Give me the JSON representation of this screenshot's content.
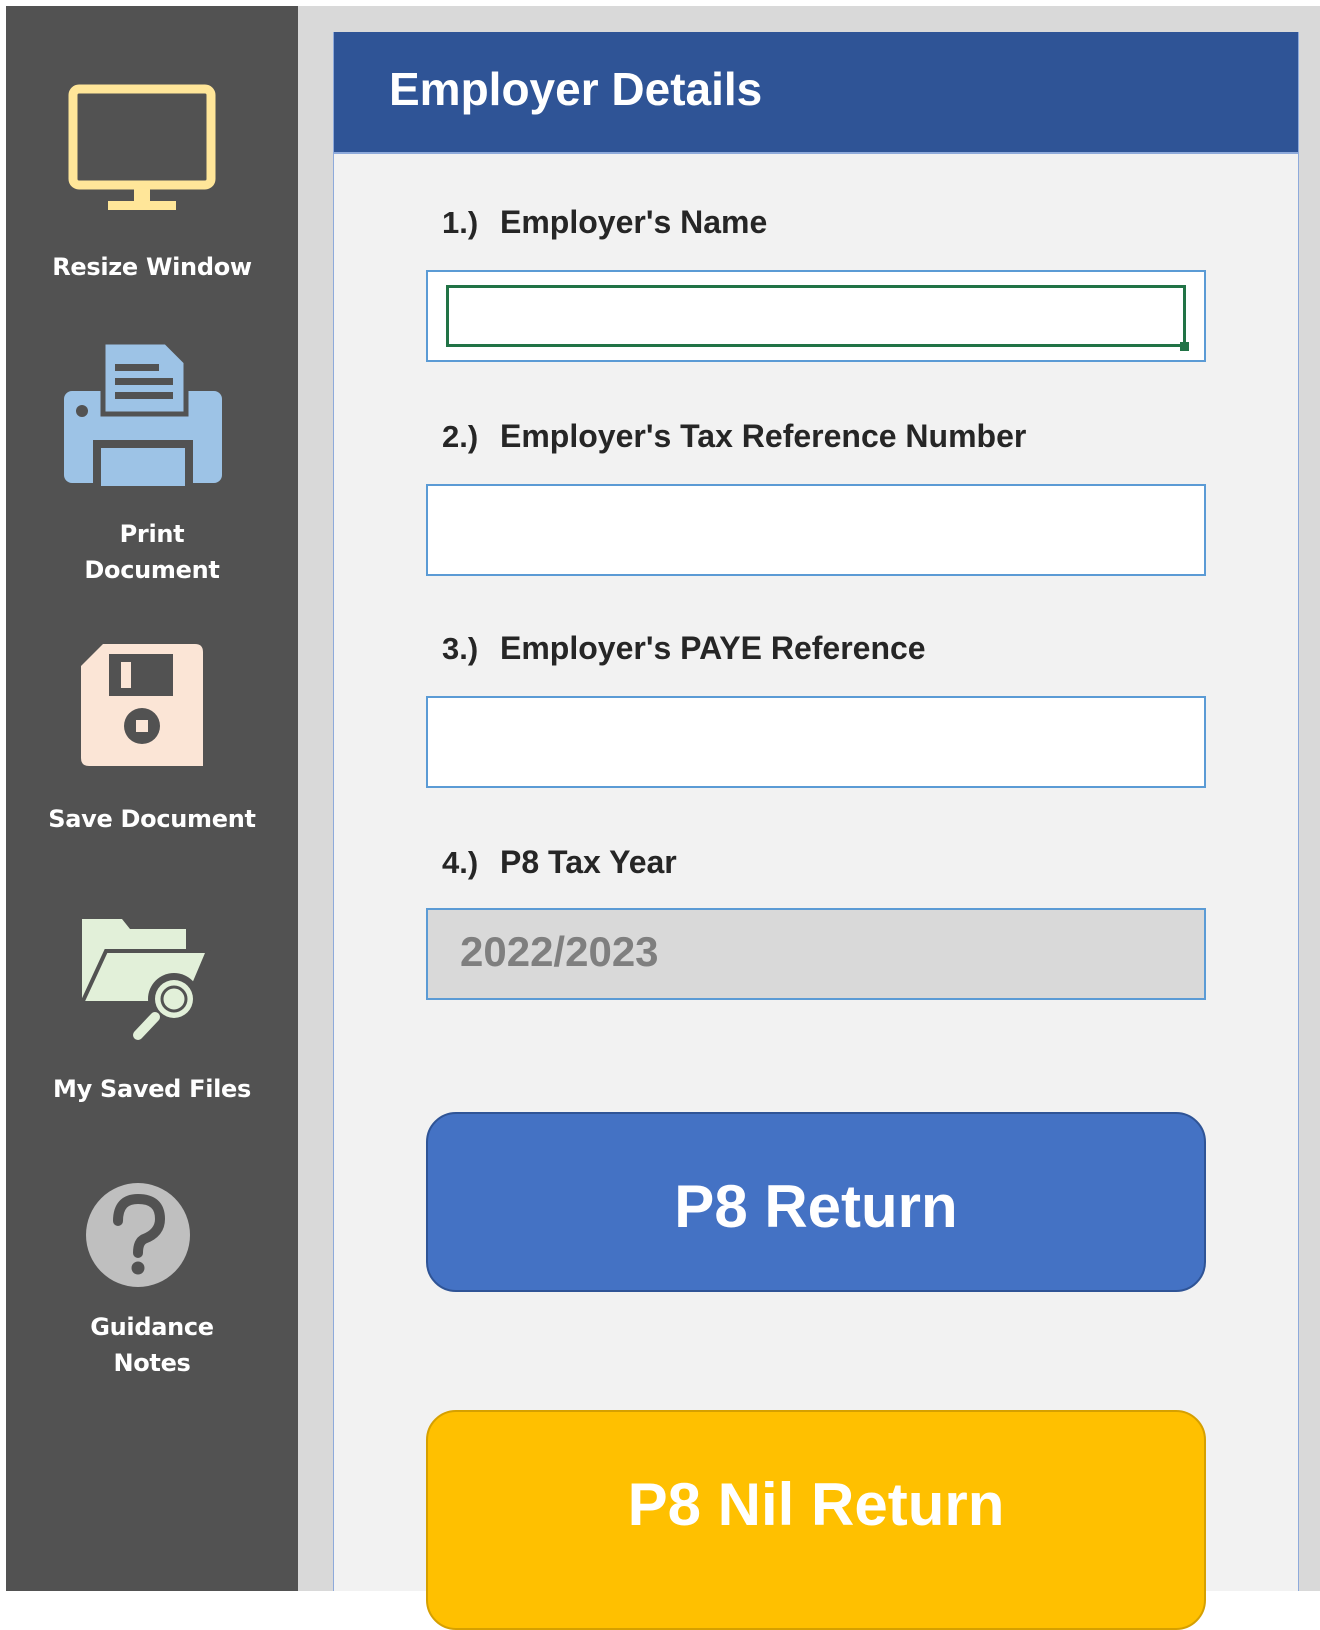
{
  "sidebar": {
    "items": [
      {
        "label": "Resize Window",
        "icon": "monitor-icon"
      },
      {
        "label": "Print\nDocument",
        "icon": "printer-icon"
      },
      {
        "label": "Save Document",
        "icon": "floppy-disk-icon"
      },
      {
        "label": "My Saved Files",
        "icon": "folder-search-icon"
      },
      {
        "label": "Guidance\nNotes",
        "icon": "help-question-icon"
      }
    ]
  },
  "panel": {
    "title": "Employer Details",
    "fields": [
      {
        "number": "1.)",
        "label": "Employer's Name",
        "value": ""
      },
      {
        "number": "2.)",
        "label": "Employer's Tax Reference Number",
        "value": ""
      },
      {
        "number": "3.)",
        "label": "Employer's PAYE Reference",
        "value": ""
      },
      {
        "number": "4.)",
        "label": "P8 Tax Year",
        "value": "2022/2023"
      }
    ],
    "buttons": {
      "p8_return": "P8 Return",
      "p8_nil_return": "P8 Nil Return"
    }
  },
  "colors": {
    "sidebar": "#525252",
    "header": "#2f5496",
    "button_blue": "#4472c4",
    "button_yellow": "#ffc000",
    "active_cell": "#217346"
  }
}
